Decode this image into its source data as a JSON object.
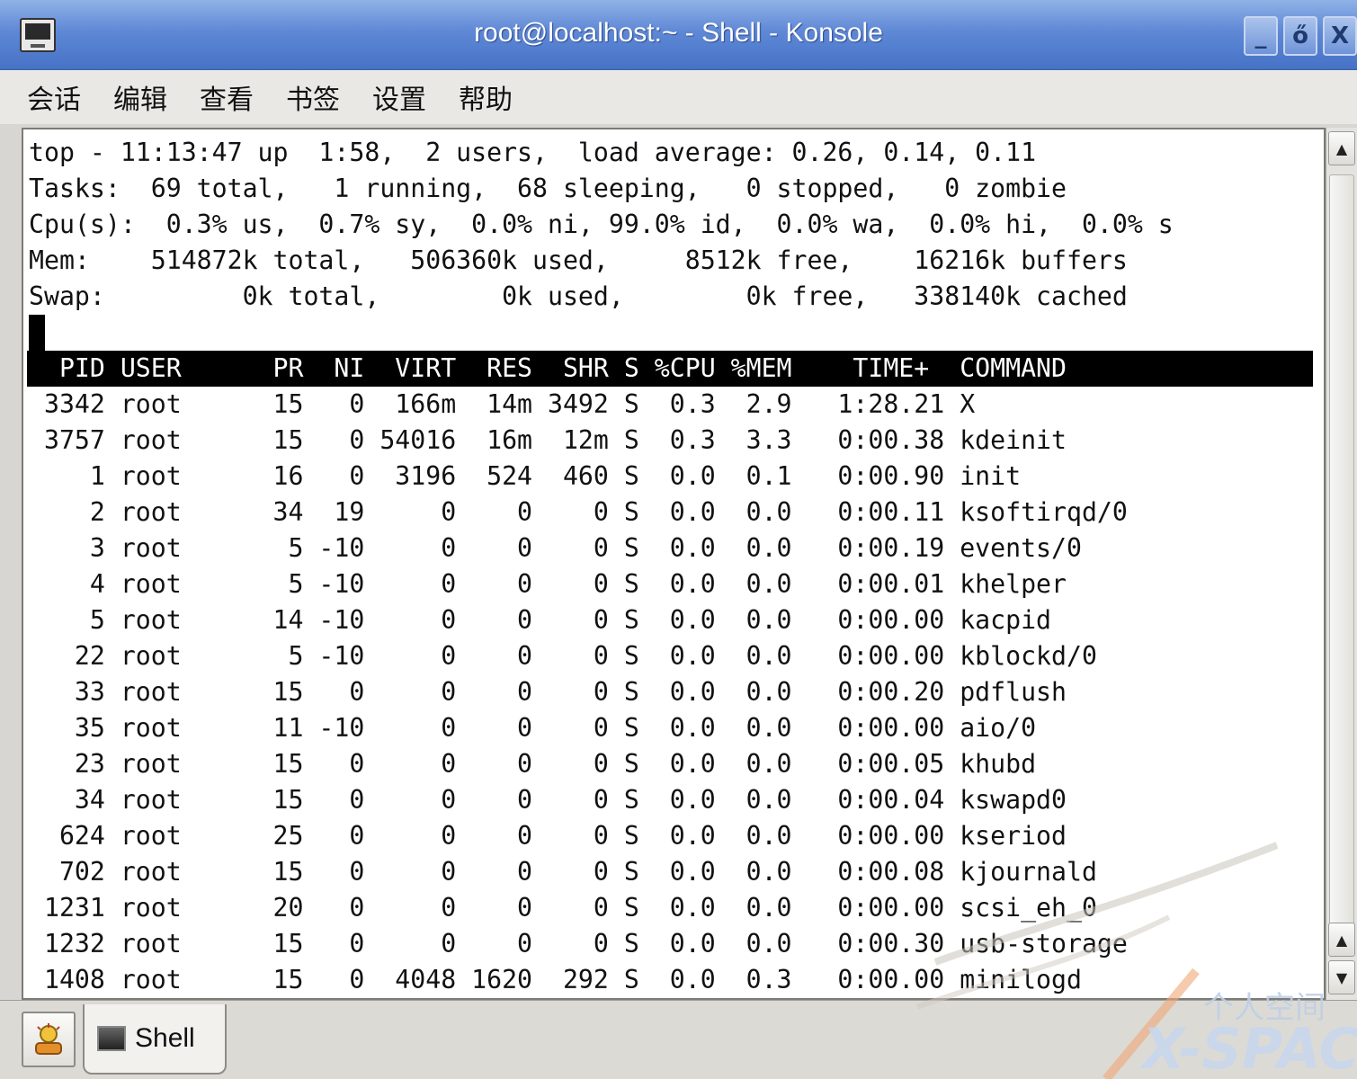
{
  "window": {
    "title": "root@localhost:~ - Shell - Konsole",
    "buttons": [
      "_",
      "ő",
      "X"
    ]
  },
  "menu": [
    "会话",
    "编辑",
    "查看",
    "书签",
    "设置",
    "帮助"
  ],
  "terminal": {
    "summary_lines": [
      "top - 11:13:47 up  1:58,  2 users,  load average: 0.26, 0.14, 0.11",
      "Tasks:  69 total,   1 running,  68 sleeping,   0 stopped,   0 zombie",
      "Cpu(s):  0.3% us,  0.7% sy,  0.0% ni, 99.0% id,  0.0% wa,  0.0% hi,  0.0% s",
      "Mem:    514872k total,   506360k used,     8512k free,    16216k buffers",
      "Swap:         0k total,        0k used,        0k free,   338140k cached"
    ],
    "header": "  PID USER      PR  NI  VIRT  RES  SHR S %CPU %MEM    TIME+  COMMAND",
    "processes": [
      " 3342 root      15   0  166m  14m 3492 S  0.3  2.9   1:28.21 X",
      " 3757 root      15   0 54016  16m  12m S  0.3  3.3   0:00.38 kdeinit",
      "    1 root      16   0  3196  524  460 S  0.0  0.1   0:00.90 init",
      "    2 root      34  19     0    0    0 S  0.0  0.0   0:00.11 ksoftirqd/0",
      "    3 root       5 -10     0    0    0 S  0.0  0.0   0:00.19 events/0",
      "    4 root       5 -10     0    0    0 S  0.0  0.0   0:00.01 khelper",
      "    5 root      14 -10     0    0    0 S  0.0  0.0   0:00.00 kacpid",
      "   22 root       5 -10     0    0    0 S  0.0  0.0   0:00.00 kblockd/0",
      "   33 root      15   0     0    0    0 S  0.0  0.0   0:00.20 pdflush",
      "   35 root      11 -10     0    0    0 S  0.0  0.0   0:00.00 aio/0",
      "   23 root      15   0     0    0    0 S  0.0  0.0   0:00.05 khubd",
      "   34 root      15   0     0    0    0 S  0.0  0.0   0:00.04 kswapd0",
      "  624 root      25   0     0    0    0 S  0.0  0.0   0:00.00 kseriod",
      "  702 root      15   0     0    0    0 S  0.0  0.0   0:00.08 kjournald",
      " 1231 root      20   0     0    0    0 S  0.0  0.0   0:00.00 scsi_eh_0",
      " 1232 root      15   0     0    0    0 S  0.0  0.0   0:00.30 usb-storage",
      " 1408 root      15   0  4048 1620  292 S  0.0  0.3   0:00.00 minilogd"
    ]
  },
  "tabs": [
    {
      "label": "Shell"
    }
  ],
  "watermark": {
    "text_cn": "个人空间",
    "text_en": "X-SPACE"
  },
  "colors": {
    "titlebar": "#5f88d6",
    "terminal_bg": "#ffffff",
    "header_bg": "#000000"
  }
}
